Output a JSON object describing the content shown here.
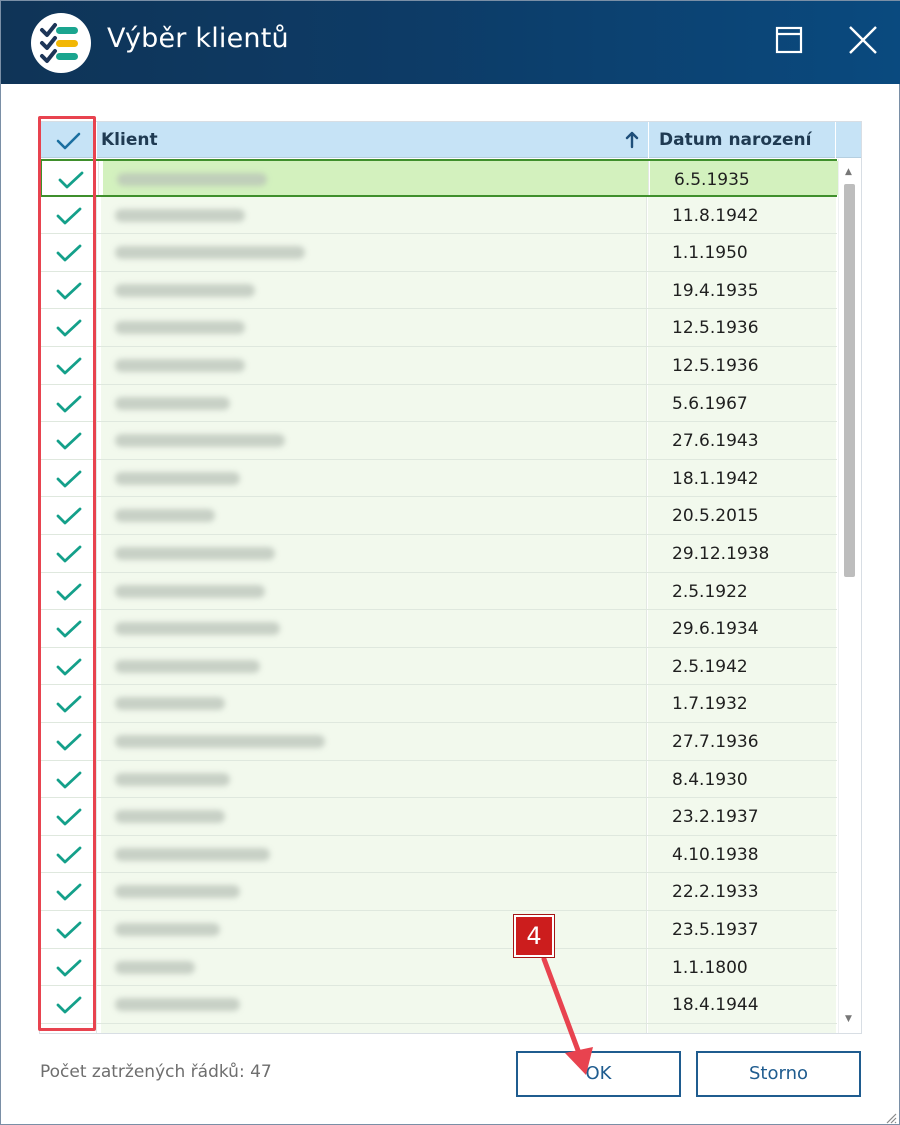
{
  "window": {
    "title": "Výběr klientů",
    "icons": {
      "app": "checklist-icon",
      "maximize": "maximize-icon",
      "close": "close-icon"
    },
    "colors": {
      "titlebar": "#0d3b66",
      "accent": "#1f5c8f",
      "check": "#14a08a",
      "selected_row": "#d3f1be",
      "selected_border": "#3f8f2c",
      "annotation": "#e8434f"
    }
  },
  "grid": {
    "columns": {
      "check_icon": "checkmark-icon",
      "client": "Klient",
      "birthdate": "Datum narození",
      "sort_icon": "sort-ascending-icon"
    },
    "rows": [
      {
        "checked": true,
        "date": "6.5.1935",
        "selected": true
      },
      {
        "checked": true,
        "date": "11.8.1942"
      },
      {
        "checked": true,
        "date": "1.1.1950"
      },
      {
        "checked": true,
        "date": "19.4.1935"
      },
      {
        "checked": true,
        "date": "12.5.1936"
      },
      {
        "checked": true,
        "date": "12.5.1936"
      },
      {
        "checked": true,
        "date": "5.6.1967"
      },
      {
        "checked": true,
        "date": "27.6.1943"
      },
      {
        "checked": true,
        "date": "18.1.1942"
      },
      {
        "checked": true,
        "date": "20.5.2015"
      },
      {
        "checked": true,
        "date": "29.12.1938"
      },
      {
        "checked": true,
        "date": "2.5.1922"
      },
      {
        "checked": true,
        "date": "29.6.1934"
      },
      {
        "checked": true,
        "date": "2.5.1942"
      },
      {
        "checked": true,
        "date": "1.7.1932"
      },
      {
        "checked": true,
        "date": "27.7.1936"
      },
      {
        "checked": true,
        "date": "8.4.1930"
      },
      {
        "checked": true,
        "date": "23.2.1937"
      },
      {
        "checked": true,
        "date": "4.10.1938"
      },
      {
        "checked": true,
        "date": "22.2.1933"
      },
      {
        "checked": true,
        "date": "23.5.1937"
      },
      {
        "checked": true,
        "date": "1.1.1800"
      },
      {
        "checked": true,
        "date": "18.4.1944"
      },
      {
        "checked": false,
        "date": ""
      }
    ]
  },
  "footer": {
    "status": "Počet zatržených řádků: 47",
    "ok_label": "OK",
    "storno_label": "Storno"
  },
  "annotation": {
    "step_number": "4"
  }
}
